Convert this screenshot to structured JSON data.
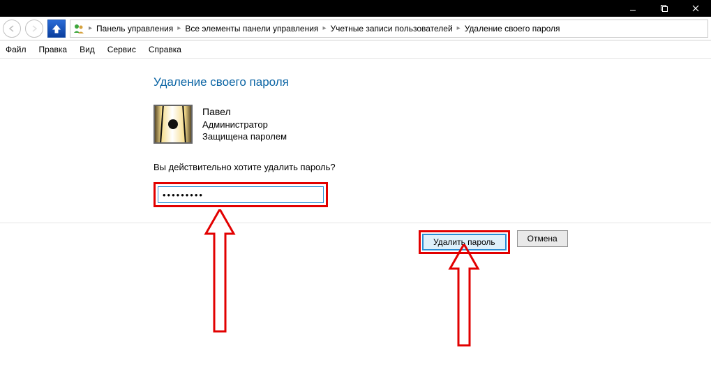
{
  "titlebar": {
    "minimize": "—",
    "maximize": "□",
    "close": "✕"
  },
  "breadcrumb": {
    "items": [
      "Панель управления",
      "Все элементы панели управления",
      "Учетные записи пользователей",
      "Удаление своего пароля"
    ]
  },
  "menu": {
    "file": "Файл",
    "edit": "Правка",
    "view": "Вид",
    "service": "Сервис",
    "help": "Справка"
  },
  "page": {
    "heading": "Удаление своего пароля",
    "user": {
      "name": "Павел",
      "role": "Администратор",
      "status": "Защищена паролем"
    },
    "confirm_text": "Вы действительно хотите удалить пароль?",
    "password_value": "•••••••••",
    "buttons": {
      "delete": "Удалить пароль",
      "cancel": "Отмена"
    }
  }
}
